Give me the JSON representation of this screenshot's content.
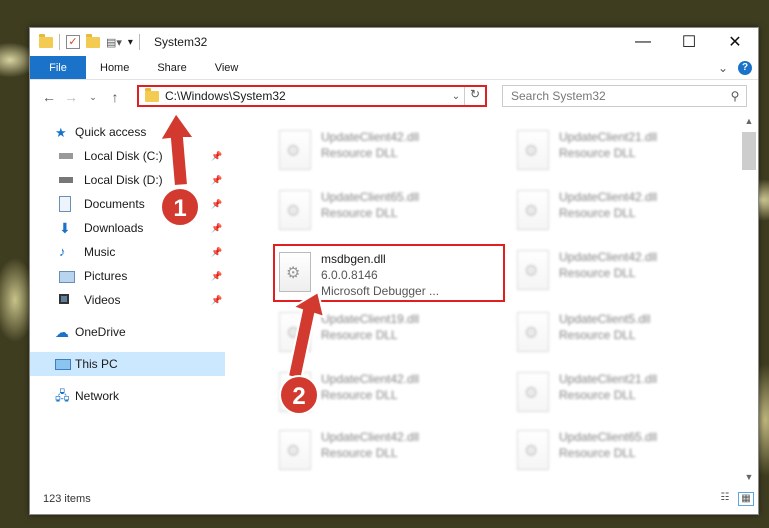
{
  "window": {
    "title": "System32",
    "controls": {
      "minimize": "—",
      "maximize": "☐",
      "close": "✕"
    }
  },
  "ribbon": {
    "tabs": [
      "File",
      "Home",
      "Share",
      "View"
    ],
    "expand": "⌄",
    "help": "?"
  },
  "address": {
    "path": "C:\\Windows\\System32",
    "dropdown": "⌄",
    "refresh": "↻"
  },
  "search": {
    "placeholder": "Search System32"
  },
  "nav": {
    "quick_access": "Quick access",
    "items": [
      {
        "label": "Local Disk (C:)",
        "icon": "drive-icon"
      },
      {
        "label": "Local Disk (D:)",
        "icon": "drive-icon"
      },
      {
        "label": "Documents",
        "icon": "documents-icon"
      },
      {
        "label": "Downloads",
        "icon": "downloads-icon"
      },
      {
        "label": "Music",
        "icon": "music-icon"
      },
      {
        "label": "Pictures",
        "icon": "pictures-icon"
      },
      {
        "label": "Videos",
        "icon": "videos-icon"
      }
    ],
    "onedrive": "OneDrive",
    "this_pc": "This PC",
    "network": "Network"
  },
  "files": {
    "left": [
      {
        "name": "UpdateClient42.dll",
        "desc": "Resource DLL"
      },
      {
        "name": "UpdateClient65.dll",
        "desc": "Resource DLL"
      },
      {
        "name": "msdbgen.dll",
        "version": "6.0.0.8146",
        "desc": "Microsoft Debugger ..."
      },
      {
        "name": "UpdateClient19.dll",
        "desc": "Resource DLL"
      },
      {
        "name": "UpdateClient42.dll",
        "desc": "Resource DLL"
      },
      {
        "name": "UpdateClient42.dll",
        "desc": "Resource DLL"
      }
    ],
    "right": [
      {
        "name": "UpdateClient21.dll",
        "desc": "Resource DLL"
      },
      {
        "name": "UpdateClient42.dll",
        "desc": "Resource DLL"
      },
      {
        "name": "UpdateClient42.dll",
        "desc": "Resource DLL"
      },
      {
        "name": "UpdateClient5.dll",
        "desc": "Resource DLL"
      },
      {
        "name": "UpdateClient21.dll",
        "desc": "Resource DLL"
      },
      {
        "name": "UpdateClient65.dll",
        "desc": "Resource DLL"
      }
    ]
  },
  "status": {
    "count": "123 items"
  },
  "annotations": {
    "badge1": "1",
    "badge2": "2"
  },
  "colors": {
    "accent": "#1a73c9",
    "highlight": "#e02020",
    "badge": "#d33a2f"
  }
}
